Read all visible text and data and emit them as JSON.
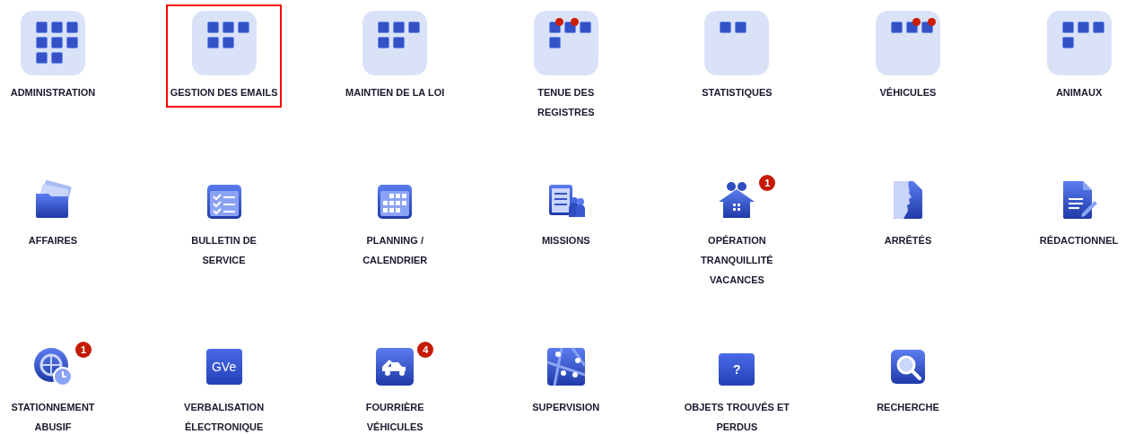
{
  "modules": [
    {
      "kind": "folder",
      "label": "ADMINISTRATION",
      "selected": false,
      "apps": [
        {
          "dot": false
        },
        {
          "dot": false
        },
        {
          "dot": false
        },
        {
          "dot": false
        },
        {
          "dot": false
        },
        {
          "dot": false
        },
        {
          "dot": false
        },
        {
          "dot": false
        }
      ]
    },
    {
      "kind": "folder",
      "label": "GESTION DES EMAILS",
      "selected": true,
      "apps": [
        {
          "dot": false
        },
        {
          "dot": false
        },
        {
          "dot": false
        },
        {
          "dot": false
        },
        {
          "dot": false
        }
      ]
    },
    {
      "kind": "folder",
      "label": "MAINTIEN DE LA LOI",
      "selected": false,
      "apps": [
        {
          "dot": false
        },
        {
          "dot": false
        },
        {
          "dot": false
        },
        {
          "dot": false
        },
        {
          "dot": false
        }
      ]
    },
    {
      "kind": "folder",
      "label": "TENUE DES\nREGISTRES",
      "selected": false,
      "apps": [
        {
          "dot": true
        },
        {
          "dot": true
        },
        {
          "dot": false
        },
        {
          "dot": false
        }
      ]
    },
    {
      "kind": "folder",
      "label": "STATISTIQUES",
      "selected": false,
      "apps": [
        {
          "dot": false
        },
        {
          "dot": false
        }
      ]
    },
    {
      "kind": "folder",
      "label": "VÉHICULES",
      "selected": false,
      "apps": [
        {
          "dot": false
        },
        {
          "dot": true
        },
        {
          "dot": true
        }
      ]
    },
    {
      "kind": "folder",
      "label": "ANIMAUX",
      "selected": false,
      "apps": [
        {
          "dot": false
        },
        {
          "dot": false
        },
        {
          "dot": false
        },
        {
          "dot": false
        }
      ]
    },
    {
      "kind": "app",
      "label": "AFFAIRES",
      "selected": false
    },
    {
      "kind": "app",
      "label": "BULLETIN DE\nSERVICE",
      "selected": false
    },
    {
      "kind": "app",
      "label": "PLANNING /\nCALENDRIER",
      "selected": false
    },
    {
      "kind": "app",
      "label": "MISSIONS",
      "selected": false
    },
    {
      "kind": "app",
      "label": "OPÉRATION\nTRANQUILLITÉ\nVACANCES",
      "selected": false,
      "badge": "1"
    },
    {
      "kind": "app",
      "label": "ARRÊTÉS",
      "selected": false
    },
    {
      "kind": "app",
      "label": "RÉDACTIONNEL",
      "selected": false
    },
    {
      "kind": "app",
      "label": "STATIONNEMENT\nABUSIF",
      "selected": false,
      "badge": "1"
    },
    {
      "kind": "app",
      "label": "VERBALISATION\nÉLECTRONIQUE",
      "selected": false,
      "icon_text": "GVe"
    },
    {
      "kind": "app",
      "label": "FOURRIÈRE\nVÉHICULES",
      "selected": false,
      "badge": "4"
    },
    {
      "kind": "app",
      "label": "SUPERVISION",
      "selected": false
    },
    {
      "kind": "app",
      "label": "OBJETS TROUVÉS ET\nPERDUS",
      "selected": false,
      "icon_text": "?"
    },
    {
      "kind": "app",
      "label": "RECHERCHE",
      "selected": false
    }
  ]
}
